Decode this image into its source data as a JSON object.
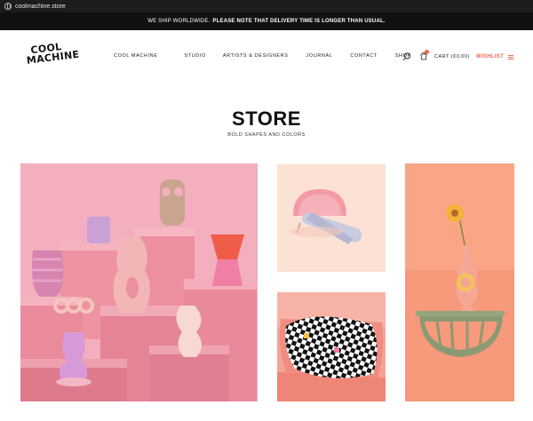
{
  "browser": {
    "url": "coolmachine.store"
  },
  "announcement": {
    "text": "WE SHIP WORLDWIDE.",
    "bold_text": "PLEASE NOTE THAT DELIVERY TIME IS LONGER THAN USUAL."
  },
  "logo": {
    "line1": "COOL",
    "line2": "MACHINE"
  },
  "nav": {
    "items": [
      {
        "label": "COOL MACHINE"
      },
      {
        "label": "STUDIO"
      },
      {
        "label": "ARTISTS & DESIGNERS"
      },
      {
        "label": "JOURNAL"
      },
      {
        "label": "CONTACT"
      },
      {
        "label": "SHOP"
      }
    ],
    "cart_label": "CART (€0,00)",
    "wishlist_label": "WISHLIST"
  },
  "page": {
    "title": "STORE",
    "subtitle": "BOLD SHAPES AND COLORS"
  },
  "icons": [
    "globe-icon",
    "search-icon",
    "cart-icon",
    "menu-icon"
  ],
  "colors": {
    "accent": "#f0674f",
    "topbar": "#111111",
    "background": "#ffffff"
  },
  "products": [
    {
      "id": "pink-ceramic-collection"
    },
    {
      "id": "pink-wall-lamp"
    },
    {
      "id": "checkered-cushion"
    },
    {
      "id": "wall-vase-shelf"
    }
  ]
}
